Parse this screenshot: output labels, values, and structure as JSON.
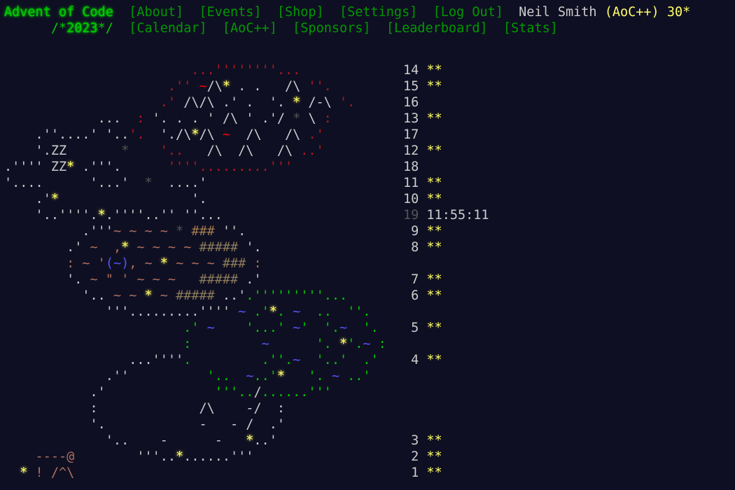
{
  "header": {
    "logo": "Advent of Code",
    "nav_top": [
      "[About]",
      "[Events]",
      "[Shop]",
      "[Settings]",
      "[Log Out]"
    ],
    "user_name": "Neil Smith",
    "supporter": "(AoC++)",
    "star_count": "30*",
    "year_prefix": "/*",
    "year": "2023",
    "year_suffix": "*/",
    "nav_bottom": [
      "[Calendar]",
      "[AoC++]",
      "[Sponsors]",
      "[Leaderboard]",
      "[Stats]"
    ]
  },
  "calendar": {
    "days": [
      {
        "day": "14",
        "stars": "**"
      },
      {
        "day": "15",
        "stars": "**"
      },
      {
        "day": "16",
        "stars": ""
      },
      {
        "day": "13",
        "stars": "**"
      },
      {
        "day": "17",
        "stars": ""
      },
      {
        "day": "12",
        "stars": "**"
      },
      {
        "day": "18",
        "stars": ""
      },
      {
        "day": "11",
        "stars": "**"
      },
      {
        "day": "10",
        "stars": "**"
      },
      {
        "day": "19",
        "stars": "",
        "countdown": "11:55:11"
      },
      {
        "day": "9",
        "stars": "**"
      },
      {
        "day": "8",
        "stars": "**"
      },
      {
        "day": "",
        "stars": ""
      },
      {
        "day": "7",
        "stars": "**"
      },
      {
        "day": "6",
        "stars": "**"
      },
      {
        "day": "",
        "stars": ""
      },
      {
        "day": "5",
        "stars": "**"
      },
      {
        "day": "",
        "stars": ""
      },
      {
        "day": "4",
        "stars": "**"
      },
      {
        "day": "",
        "stars": ""
      },
      {
        "day": "",
        "stars": ""
      },
      {
        "day": "",
        "stars": ""
      },
      {
        "day": "3",
        "stars": "**"
      },
      {
        "day": "2",
        "stars": "**"
      },
      {
        "day": "1",
        "stars": "**"
      }
    ]
  }
}
